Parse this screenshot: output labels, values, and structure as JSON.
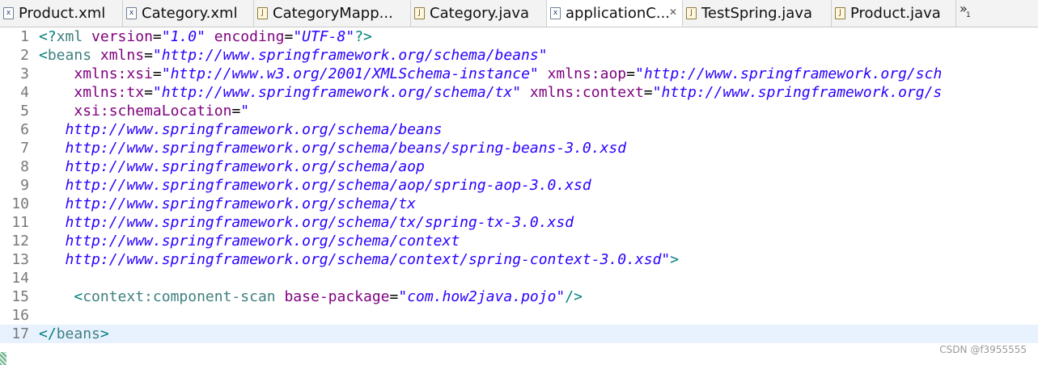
{
  "tabs": [
    {
      "label": "Product.xml",
      "icon": "xml-file-icon",
      "glyph": "x",
      "active": false
    },
    {
      "label": "Category.xml",
      "icon": "xml-file-icon",
      "glyph": "x",
      "active": false
    },
    {
      "label": "CategoryMapp...",
      "icon": "java-file-icon",
      "glyph": "J",
      "active": false
    },
    {
      "label": "Category.java",
      "icon": "java-file-icon",
      "glyph": "J",
      "active": false
    },
    {
      "label": "applicationC...",
      "icon": "xml-file-icon",
      "glyph": "x",
      "active": true,
      "close": "✕"
    },
    {
      "label": "TestSpring.java",
      "icon": "java-file-icon",
      "glyph": "J",
      "active": false
    },
    {
      "label": "Product.java",
      "icon": "java-file-icon",
      "glyph": "J",
      "active": false
    }
  ],
  "overflow": {
    "chevron": "»",
    "count": "1"
  },
  "editor": {
    "current_line": 17,
    "lines": [
      {
        "n": "1",
        "tokens": [
          [
            "b",
            "<?"
          ],
          [
            "t",
            "xml"
          ],
          [
            "s",
            " "
          ],
          [
            "a",
            "version"
          ],
          [
            "e",
            "="
          ],
          [
            "v",
            "\"1.0\""
          ],
          [
            "s",
            " "
          ],
          [
            "a",
            "encoding"
          ],
          [
            "e",
            "="
          ],
          [
            "v",
            "\"UTF-8\""
          ],
          [
            "b",
            "?>"
          ]
        ]
      },
      {
        "n": "2",
        "tokens": [
          [
            "b",
            "<"
          ],
          [
            "t",
            "beans"
          ],
          [
            "s",
            " "
          ],
          [
            "a",
            "xmlns"
          ],
          [
            "e",
            "="
          ],
          [
            "v",
            "\"http://www.springframework.org/schema/beans\""
          ]
        ]
      },
      {
        "n": "3",
        "tokens": [
          [
            "s",
            "    "
          ],
          [
            "a",
            "xmlns:xsi"
          ],
          [
            "e",
            "="
          ],
          [
            "v",
            "\"http://www.w3.org/2001/XMLSchema-instance\""
          ],
          [
            "s",
            " "
          ],
          [
            "a",
            "xmlns:aop"
          ],
          [
            "e",
            "="
          ],
          [
            "v",
            "\"http://www.springframework.org/sch"
          ]
        ]
      },
      {
        "n": "4",
        "tokens": [
          [
            "s",
            "    "
          ],
          [
            "a",
            "xmlns:tx"
          ],
          [
            "e",
            "="
          ],
          [
            "v",
            "\"http://www.springframework.org/schema/tx\""
          ],
          [
            "s",
            " "
          ],
          [
            "a",
            "xmlns:context"
          ],
          [
            "e",
            "="
          ],
          [
            "v",
            "\"http://www.springframework.org/s"
          ]
        ]
      },
      {
        "n": "5",
        "tokens": [
          [
            "s",
            "    "
          ],
          [
            "a",
            "xsi:schemaLocation"
          ],
          [
            "e",
            "="
          ],
          [
            "v",
            "\""
          ]
        ]
      },
      {
        "n": "6",
        "tokens": [
          [
            "s",
            "   "
          ],
          [
            "v",
            "http://www.springframework.org/schema/beans"
          ]
        ]
      },
      {
        "n": "7",
        "tokens": [
          [
            "s",
            "   "
          ],
          [
            "v",
            "http://www.springframework.org/schema/beans/spring-beans-3.0.xsd"
          ]
        ]
      },
      {
        "n": "8",
        "tokens": [
          [
            "s",
            "   "
          ],
          [
            "v",
            "http://www.springframework.org/schema/aop"
          ]
        ]
      },
      {
        "n": "9",
        "tokens": [
          [
            "s",
            "   "
          ],
          [
            "v",
            "http://www.springframework.org/schema/aop/spring-aop-3.0.xsd"
          ]
        ]
      },
      {
        "n": "10",
        "tokens": [
          [
            "s",
            "   "
          ],
          [
            "v",
            "http://www.springframework.org/schema/tx"
          ]
        ]
      },
      {
        "n": "11",
        "tokens": [
          [
            "s",
            "   "
          ],
          [
            "v",
            "http://www.springframework.org/schema/tx/spring-tx-3.0.xsd"
          ]
        ]
      },
      {
        "n": "12",
        "tokens": [
          [
            "s",
            "   "
          ],
          [
            "v",
            "http://www.springframework.org/schema/context"
          ]
        ]
      },
      {
        "n": "13",
        "tokens": [
          [
            "s",
            "   "
          ],
          [
            "v",
            "http://www.springframework.org/schema/context/spring-context-3.0.xsd\""
          ],
          [
            "b",
            ">"
          ]
        ]
      },
      {
        "n": "14",
        "tokens": []
      },
      {
        "n": "15",
        "tokens": [
          [
            "s",
            "    "
          ],
          [
            "b",
            "<"
          ],
          [
            "t",
            "context:component-scan"
          ],
          [
            "s",
            " "
          ],
          [
            "a",
            "base-package"
          ],
          [
            "e",
            "="
          ],
          [
            "v",
            "\"com.how2java.pojo\""
          ],
          [
            "b",
            "/>"
          ]
        ]
      },
      {
        "n": "16",
        "tokens": []
      },
      {
        "n": "17",
        "tokens": [
          [
            "b",
            "</"
          ],
          [
            "t",
            "beans"
          ],
          [
            "b",
            ">"
          ]
        ]
      }
    ]
  },
  "watermark": "CSDN @f3955555"
}
